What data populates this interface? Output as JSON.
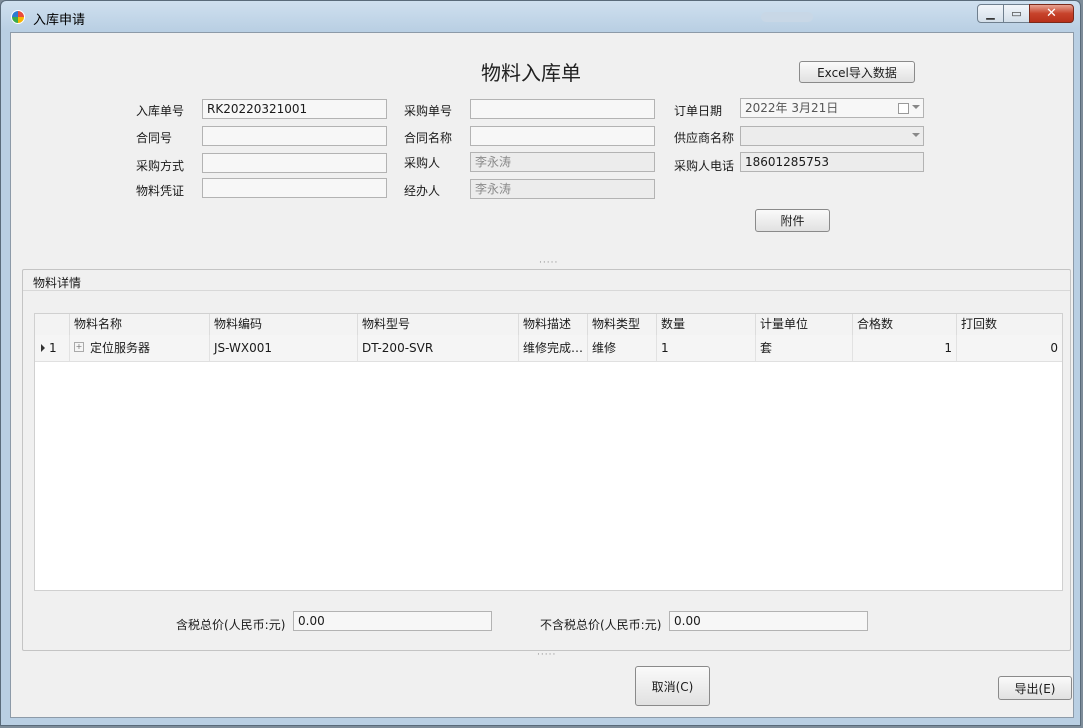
{
  "window": {
    "title": "入库申请"
  },
  "header": {
    "form_title": "物料入库单",
    "excel_button": "Excel导入数据",
    "attach_button": "附件"
  },
  "form": {
    "order_no": {
      "label": "入库单号",
      "value": "RK20220321001"
    },
    "purchase_no": {
      "label": "采购单号",
      "value": ""
    },
    "order_date": {
      "label": "订单日期",
      "value": "2022年  3月21日"
    },
    "contract_no": {
      "label": "合同号",
      "value": ""
    },
    "contract_name": {
      "label": "合同名称",
      "value": ""
    },
    "supplier": {
      "label": "供应商名称",
      "value": ""
    },
    "purchase_method": {
      "label": "采购方式",
      "value": ""
    },
    "purchaser": {
      "label": "采购人",
      "value": "李永涛"
    },
    "purchaser_phone": {
      "label": "采购人电话",
      "value": "18601285753"
    },
    "voucher": {
      "label": "物料凭证",
      "value": ""
    },
    "handler": {
      "label": "经办人",
      "value": "李永涛"
    }
  },
  "details": {
    "title": "物料详情",
    "columns": [
      "物料名称",
      "物料编码",
      "物料型号",
      "物料描述",
      "物料类型",
      "数量",
      "计量单位",
      "合格数",
      "打回数"
    ],
    "rows": [
      {
        "index": "1",
        "name": "定位服务器",
        "code": "JS-WX001",
        "model": "DT-200-SVR",
        "desc": "维修完成…",
        "type": "维修",
        "qty": "1",
        "unit": "套",
        "passed": "1",
        "returned": "0"
      }
    ]
  },
  "totals": {
    "tax_incl_label": "含税总价(人民币:元)",
    "tax_incl_value": "0.00",
    "tax_excl_label": "不含税总价(人民币:元)",
    "tax_excl_value": "0.00"
  },
  "footer": {
    "cancel_button": "取消(C)",
    "export_button": "导出(E)"
  }
}
